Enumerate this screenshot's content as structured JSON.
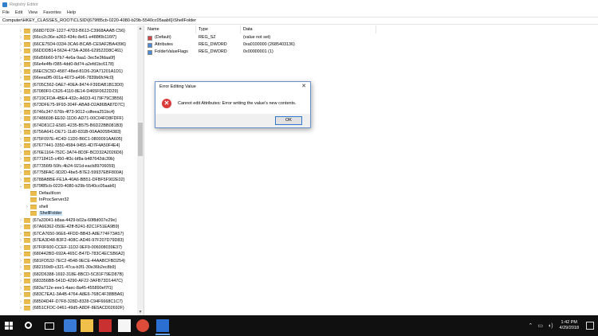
{
  "window": {
    "title": "Registry Editor",
    "menu": [
      "File",
      "Edit",
      "View",
      "Favorites",
      "Help"
    ],
    "address": "Computer\\HKEY_CLASSES_ROOT\\CLSID\\{679f85cb-0220-4080-b29b-5540cc05aab6}\\ShellFolder"
  },
  "tree": {
    "items": [
      {
        "label": "{668D7D2F-1227-47D3-B613-C3968AAAB C56}",
        "level": 1,
        "chev": "›"
      },
      {
        "label": "{66cc2c36e-a363-434c-8e61-e488f0b116f7}",
        "level": 1,
        "chev": "›"
      },
      {
        "label": "{66CE75D4-0334-3CA6-BCAB-CE9AF2BA4396}",
        "level": 1,
        "chev": "›"
      },
      {
        "label": "{66DDDB14-5634-473A-A366-629522D8C461}",
        "level": 1,
        "chev": "›"
      },
      {
        "label": "{66d56b60-97b7-4e6a-9aa1-3ec5e3fdaa0f}",
        "level": 1,
        "chev": "›"
      },
      {
        "label": "{66e4e4fb-f385-4dd0-8d74-a2efd1bc6178}",
        "level": 1,
        "chev": "›"
      },
      {
        "label": "{66EC5C5D-4587-48ed-81D6-20A71201A1D1}",
        "level": 1,
        "chev": "›"
      },
      {
        "label": "{66eea0f5-001a-4073-a496-7839b6fcf4c0}",
        "level": 1,
        "chev": "›"
      },
      {
        "label": "{6705C562-0AE7-40EA-8474-F39DAB1B13D0}",
        "level": 1,
        "chev": "›"
      },
      {
        "label": "{67080F0-C626-4110-8E14-D465F0622D29}",
        "level": 1,
        "chev": "›"
      },
      {
        "label": "{6719CFDA-4BE4-432c-A6D3-4179F79C3B56}",
        "level": 1,
        "chev": "›"
      },
      {
        "label": "{673DFE75-9F93-304F-ABA8-D2A86BA87D7C}",
        "level": 1,
        "chev": "›"
      },
      {
        "label": "{6746c347-576b-4f73-9012-cdfeea251bc4}",
        "level": 1,
        "chev": "›"
      },
      {
        "label": "{67486698-EE92-11D0-AD71-00C04FD8FDFF}",
        "level": 1,
        "chev": "›"
      },
      {
        "label": "{674D81C2-E581-4235-B575-B6D22BB081B3}",
        "level": 1,
        "chev": "›"
      },
      {
        "label": "{6756A641-DE71-11d0-831B-00AA005B4383}",
        "level": 1,
        "chev": "›"
      },
      {
        "label": "{675F097E-4C4D-11D0-B6C1-0800091AA605}",
        "level": 1,
        "chev": "›"
      },
      {
        "label": "{67677441-3350-4584-9455-4D7F4A50F4E4}",
        "level": 1,
        "chev": "›"
      },
      {
        "label": "{676E1164-752C-3A74-8D3F-BCD32A2026D6}",
        "level": 1,
        "chev": "›"
      },
      {
        "label": "{67718415-c450-4f3c-bf8a-b487642dc39b}",
        "level": 1,
        "chev": "›"
      },
      {
        "label": "{677356f9-50fc-4b24-921d-eacb89706059}",
        "level": 1,
        "chev": "›"
      },
      {
        "label": "{67758FAC-9D2D-4be5-B7E2-59937EBF800A}",
        "level": 1,
        "chev": "›"
      },
      {
        "label": "{6788ABBE-FE1A-40A6-BB51-DFBF5F902E02}",
        "level": 1,
        "chev": "›"
      },
      {
        "label": "{679f85cb-0220-4080-b29b-5540cc05aab6}",
        "level": 1,
        "chev": "⌄"
      },
      {
        "label": "DefaultIcon",
        "level": 2,
        "chev": ""
      },
      {
        "label": "InProcServer32",
        "level": 2,
        "chev": ""
      },
      {
        "label": "shell",
        "level": 2,
        "chev": "›"
      },
      {
        "label": "ShellFolder",
        "level": 2,
        "chev": "",
        "selected": true
      },
      {
        "label": "{67a33041-b8aa-4429-b02a-60f8d007e29e}",
        "level": 1,
        "chev": "›"
      },
      {
        "label": "{67A66362-050E-42ff-B241-82C1F51EA9B9}",
        "level": 1,
        "chev": "›"
      },
      {
        "label": "{67CA7650-96E6-4FDD-BB43-A8E774F73A57}",
        "level": 1,
        "chev": "›"
      },
      {
        "label": "{67EA3D48-B3F2-408C-AD46-97F207D79D83}",
        "level": 1,
        "chev": "›"
      },
      {
        "label": "{67F0F600-CCEF-11D2-9EF9-006008039E37}",
        "level": 1,
        "chev": "›"
      },
      {
        "label": "{680442BD-692A-465C-B47D-783C4ECSB6A2}",
        "level": 1,
        "chev": "›"
      },
      {
        "label": "{681FD532-7EC2-4548-9ECE-44AABCFBD254}",
        "level": 1,
        "chev": "›"
      },
      {
        "label": "{682159d9-c321-47ca-b3f1-30e36b2ec8b9}",
        "level": 1,
        "chev": "›"
      },
      {
        "label": "{682D6388-1692-318E-8BCD-5C81F79ED87B}",
        "level": 1,
        "chev": "›"
      },
      {
        "label": "{683356BB-541D-4290-AF22-3AFB73D1447C}",
        "level": 1,
        "chev": "›"
      },
      {
        "label": "{683a712e-eee1-4aec-8a45-455890ef7f1}",
        "level": 1,
        "chev": "›"
      },
      {
        "label": "{683C7EA1-3A4B-4764-A8E6-768C4F38BBA6}",
        "level": 1,
        "chev": "›"
      },
      {
        "label": "{68504D4F-D7F8-328D-8328-C94F6668C1C7}",
        "level": 1,
        "chev": "›"
      },
      {
        "label": "{6851CFDC-0461-49d5-A8DF-8E5ACD02692F}",
        "level": 1,
        "chev": "›"
      }
    ]
  },
  "values": {
    "headers": {
      "name": "Name",
      "type": "Type",
      "data": "Data"
    },
    "rows": [
      {
        "name": "(Default)",
        "type": "REG_SZ",
        "data": "(value not set)",
        "icon": "sz"
      },
      {
        "name": "Attributes",
        "type": "REG_DWORD",
        "data": "0xa0100000 (2685403136)",
        "icon": "dword"
      },
      {
        "name": "FolderValueFlags",
        "type": "REG_DWORD",
        "data": "0x00000001 (1)",
        "icon": "dword"
      }
    ]
  },
  "dialog": {
    "title": "Error Editing Value",
    "close": "✕",
    "icon_symbol": "✕",
    "message": "Cannot edit Attributes:  Error writing the value's new contents.",
    "ok_label": "OK"
  },
  "taskbar": {
    "time": "1:42 PM",
    "date": "4/29/2018",
    "tray_symbols": [
      "⌃",
      "▭",
      "◖)"
    ]
  }
}
